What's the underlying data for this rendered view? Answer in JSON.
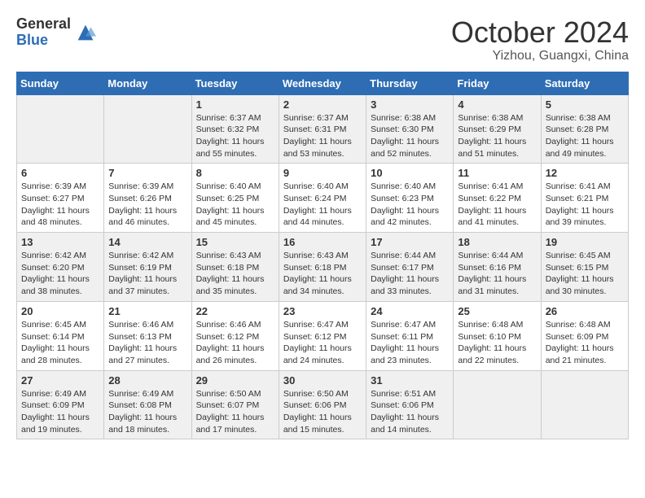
{
  "header": {
    "logo_general": "General",
    "logo_blue": "Blue",
    "month_title": "October 2024",
    "subtitle": "Yizhou, Guangxi, China"
  },
  "weekdays": [
    "Sunday",
    "Monday",
    "Tuesday",
    "Wednesday",
    "Thursday",
    "Friday",
    "Saturday"
  ],
  "weeks": [
    [
      {
        "day": "",
        "info": ""
      },
      {
        "day": "",
        "info": ""
      },
      {
        "day": "1",
        "info": "Sunrise: 6:37 AM\nSunset: 6:32 PM\nDaylight: 11 hours\nand 55 minutes."
      },
      {
        "day": "2",
        "info": "Sunrise: 6:37 AM\nSunset: 6:31 PM\nDaylight: 11 hours\nand 53 minutes."
      },
      {
        "day": "3",
        "info": "Sunrise: 6:38 AM\nSunset: 6:30 PM\nDaylight: 11 hours\nand 52 minutes."
      },
      {
        "day": "4",
        "info": "Sunrise: 6:38 AM\nSunset: 6:29 PM\nDaylight: 11 hours\nand 51 minutes."
      },
      {
        "day": "5",
        "info": "Sunrise: 6:38 AM\nSunset: 6:28 PM\nDaylight: 11 hours\nand 49 minutes."
      }
    ],
    [
      {
        "day": "6",
        "info": "Sunrise: 6:39 AM\nSunset: 6:27 PM\nDaylight: 11 hours\nand 48 minutes."
      },
      {
        "day": "7",
        "info": "Sunrise: 6:39 AM\nSunset: 6:26 PM\nDaylight: 11 hours\nand 46 minutes."
      },
      {
        "day": "8",
        "info": "Sunrise: 6:40 AM\nSunset: 6:25 PM\nDaylight: 11 hours\nand 45 minutes."
      },
      {
        "day": "9",
        "info": "Sunrise: 6:40 AM\nSunset: 6:24 PM\nDaylight: 11 hours\nand 44 minutes."
      },
      {
        "day": "10",
        "info": "Sunrise: 6:40 AM\nSunset: 6:23 PM\nDaylight: 11 hours\nand 42 minutes."
      },
      {
        "day": "11",
        "info": "Sunrise: 6:41 AM\nSunset: 6:22 PM\nDaylight: 11 hours\nand 41 minutes."
      },
      {
        "day": "12",
        "info": "Sunrise: 6:41 AM\nSunset: 6:21 PM\nDaylight: 11 hours\nand 39 minutes."
      }
    ],
    [
      {
        "day": "13",
        "info": "Sunrise: 6:42 AM\nSunset: 6:20 PM\nDaylight: 11 hours\nand 38 minutes."
      },
      {
        "day": "14",
        "info": "Sunrise: 6:42 AM\nSunset: 6:19 PM\nDaylight: 11 hours\nand 37 minutes."
      },
      {
        "day": "15",
        "info": "Sunrise: 6:43 AM\nSunset: 6:18 PM\nDaylight: 11 hours\nand 35 minutes."
      },
      {
        "day": "16",
        "info": "Sunrise: 6:43 AM\nSunset: 6:18 PM\nDaylight: 11 hours\nand 34 minutes."
      },
      {
        "day": "17",
        "info": "Sunrise: 6:44 AM\nSunset: 6:17 PM\nDaylight: 11 hours\nand 33 minutes."
      },
      {
        "day": "18",
        "info": "Sunrise: 6:44 AM\nSunset: 6:16 PM\nDaylight: 11 hours\nand 31 minutes."
      },
      {
        "day": "19",
        "info": "Sunrise: 6:45 AM\nSunset: 6:15 PM\nDaylight: 11 hours\nand 30 minutes."
      }
    ],
    [
      {
        "day": "20",
        "info": "Sunrise: 6:45 AM\nSunset: 6:14 PM\nDaylight: 11 hours\nand 28 minutes."
      },
      {
        "day": "21",
        "info": "Sunrise: 6:46 AM\nSunset: 6:13 PM\nDaylight: 11 hours\nand 27 minutes."
      },
      {
        "day": "22",
        "info": "Sunrise: 6:46 AM\nSunset: 6:12 PM\nDaylight: 11 hours\nand 26 minutes."
      },
      {
        "day": "23",
        "info": "Sunrise: 6:47 AM\nSunset: 6:12 PM\nDaylight: 11 hours\nand 24 minutes."
      },
      {
        "day": "24",
        "info": "Sunrise: 6:47 AM\nSunset: 6:11 PM\nDaylight: 11 hours\nand 23 minutes."
      },
      {
        "day": "25",
        "info": "Sunrise: 6:48 AM\nSunset: 6:10 PM\nDaylight: 11 hours\nand 22 minutes."
      },
      {
        "day": "26",
        "info": "Sunrise: 6:48 AM\nSunset: 6:09 PM\nDaylight: 11 hours\nand 21 minutes."
      }
    ],
    [
      {
        "day": "27",
        "info": "Sunrise: 6:49 AM\nSunset: 6:09 PM\nDaylight: 11 hours\nand 19 minutes."
      },
      {
        "day": "28",
        "info": "Sunrise: 6:49 AM\nSunset: 6:08 PM\nDaylight: 11 hours\nand 18 minutes."
      },
      {
        "day": "29",
        "info": "Sunrise: 6:50 AM\nSunset: 6:07 PM\nDaylight: 11 hours\nand 17 minutes."
      },
      {
        "day": "30",
        "info": "Sunrise: 6:50 AM\nSunset: 6:06 PM\nDaylight: 11 hours\nand 15 minutes."
      },
      {
        "day": "31",
        "info": "Sunrise: 6:51 AM\nSunset: 6:06 PM\nDaylight: 11 hours\nand 14 minutes."
      },
      {
        "day": "",
        "info": ""
      },
      {
        "day": "",
        "info": ""
      }
    ]
  ]
}
